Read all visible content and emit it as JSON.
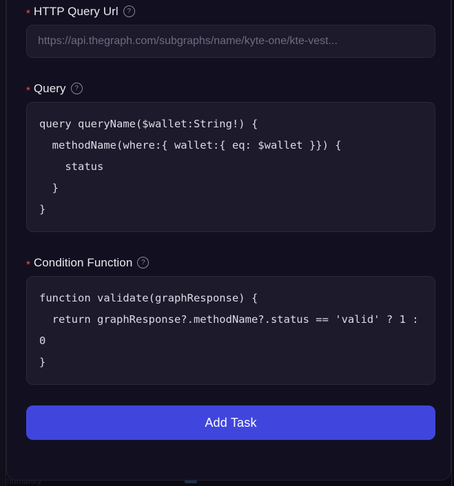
{
  "backdrop": {
    "ghost_text": "humanity"
  },
  "form": {
    "fields": [
      {
        "label": "HTTP Query Url",
        "required_marker": "*",
        "help_icon": "question-mark-circle-icon",
        "value": "",
        "placeholder": "https://api.thegraph.com/subgraphs/name/kyte-one/kte-vest..."
      },
      {
        "label": "Query",
        "required_marker": "*",
        "help_icon": "question-mark-circle-icon",
        "value": "query queryName($wallet:String!) {\n  methodName(where:{ wallet:{ eq: $wallet }}) {\n    status\n  }\n}"
      },
      {
        "label": "Condition Function",
        "required_marker": "*",
        "help_icon": "question-mark-circle-icon",
        "value": "function validate(graphResponse) {\n  return graphResponse?.methodName?.status == 'valid' ? 1 : 0\n}"
      }
    ],
    "submit_label": "Add Task"
  },
  "colors": {
    "panel_background": "#121020",
    "field_background": "#1c1a2b",
    "accent_button": "#4046dd",
    "required_asterisk": "#ff4d4f",
    "placeholder_text": "#6e6d80",
    "code_text": "#dcdce6"
  }
}
